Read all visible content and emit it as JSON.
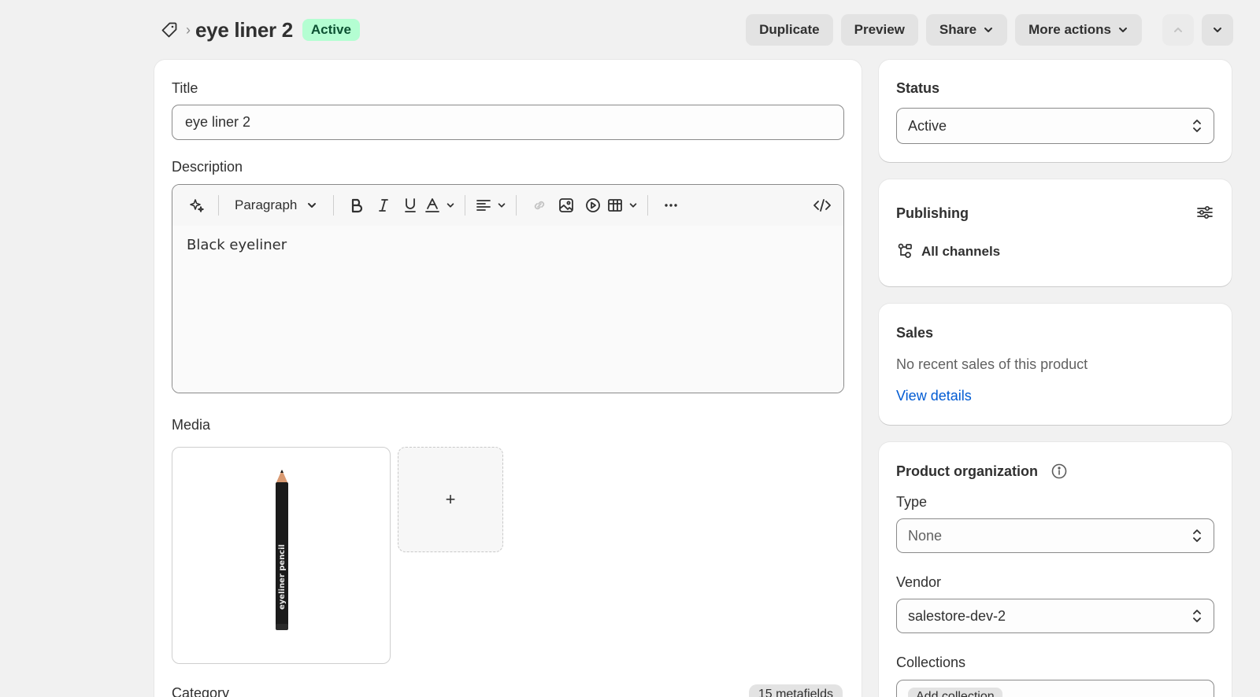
{
  "header": {
    "title": "eye liner 2",
    "status_badge": "Active",
    "actions": {
      "duplicate": "Duplicate",
      "preview": "Preview",
      "share": "Share",
      "more_actions": "More actions"
    }
  },
  "main": {
    "title_label": "Title",
    "title_value": "eye liner 2",
    "description_label": "Description",
    "toolbar": {
      "paragraph": "Paragraph"
    },
    "description_text": "Black eyeliner",
    "media_label": "Media",
    "media_add": "+",
    "media_image_name": "eyeliner pencil",
    "category_label": "Category",
    "metafields_badge": "15 metafields"
  },
  "sidebar": {
    "status": {
      "title": "Status",
      "value": "Active"
    },
    "publishing": {
      "title": "Publishing",
      "channels": "All channels"
    },
    "sales": {
      "title": "Sales",
      "text": "No recent sales of this product",
      "link": "View details"
    },
    "organization": {
      "title": "Product organization",
      "type_label": "Type",
      "type_value": "None",
      "vendor_label": "Vendor",
      "vendor_value": "salestore-dev-2",
      "collections_label": "Collections",
      "collections_placeholder": "Add collection"
    }
  },
  "colors": {
    "badge_bg": "#b4fed2",
    "badge_text": "#0c5132",
    "link": "#005bd3",
    "page_bg": "#f1f1f1"
  },
  "icons": [
    "tag-icon",
    "chevron-right-icon",
    "chevron-down-icon",
    "chevron-up-icon",
    "magic-icon",
    "bold-icon",
    "italic-icon",
    "underline-icon",
    "text-color-icon",
    "align-icon",
    "link-icon",
    "image-icon",
    "video-icon",
    "table-icon",
    "more-icon",
    "code-icon",
    "settings-sliders-icon",
    "channels-icon",
    "info-icon",
    "select-arrows-icon"
  ]
}
